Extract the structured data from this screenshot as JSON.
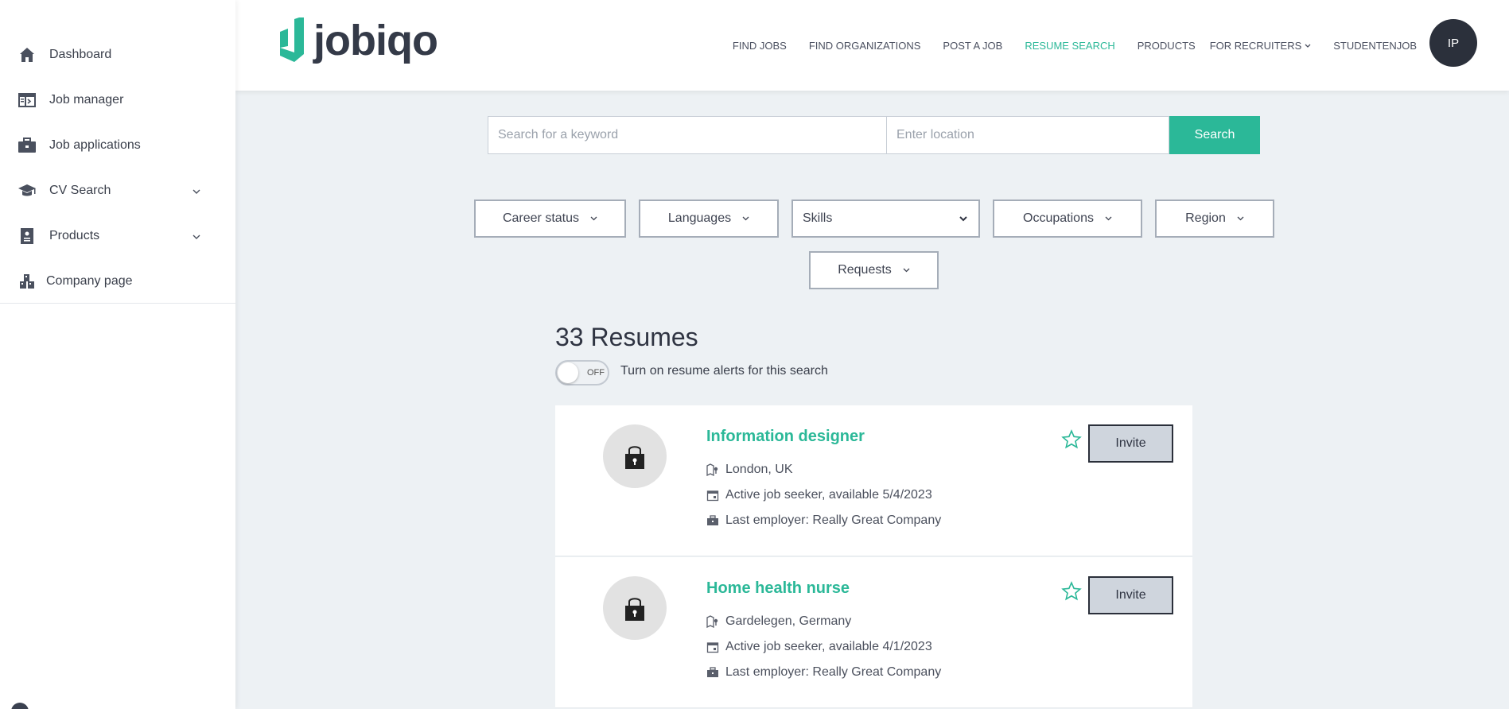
{
  "sidebar": {
    "items": [
      {
        "label": "Dashboard",
        "icon": "home-icon"
      },
      {
        "label": "Job manager",
        "icon": "job-manager-icon"
      },
      {
        "label": "Job applications",
        "icon": "briefcase-icon"
      },
      {
        "label": "CV Search",
        "icon": "graduation-cap-icon",
        "expandable": true
      },
      {
        "label": "Products",
        "icon": "products-icon",
        "expandable": true
      },
      {
        "label": "Company page",
        "icon": "company-icon"
      }
    ]
  },
  "header": {
    "logo_text": "jobiqo",
    "nav": [
      {
        "label": "FIND JOBS",
        "active": false
      },
      {
        "label": "FIND ORGANIZATIONS",
        "active": false
      },
      {
        "label": "POST A JOB",
        "active": false
      },
      {
        "label": "RESUME SEARCH",
        "active": true
      },
      {
        "label": "PRODUCTS",
        "active": false
      },
      {
        "label": "FOR RECRUITERS",
        "active": false,
        "dropdown": true
      },
      {
        "label": "STUDENTENJOB",
        "active": false
      }
    ],
    "avatar_initials": "IP"
  },
  "search": {
    "keyword_placeholder": "Search for a keyword",
    "location_placeholder": "Enter location",
    "button_label": "Search"
  },
  "filters": {
    "career_status": "Career status",
    "languages": "Languages",
    "skills": "Skills",
    "occupations": "Occupations",
    "region": "Region",
    "requests": "Requests"
  },
  "results": {
    "count_label": "33 Resumes",
    "toggle_state": "OFF",
    "alert_text": "Turn on resume alerts for this search",
    "cards": [
      {
        "title": "Information designer",
        "location": "London, UK",
        "status": "Active job seeker, available 5/4/2023",
        "employer": "Last employer: Really Great Company",
        "invite_label": "Invite"
      },
      {
        "title": "Home health nurse",
        "location": "Gardelegen, Germany",
        "status": "Active job seeker, available 4/1/2023",
        "employer": "Last employer: Really Great Company",
        "invite_label": "Invite"
      }
    ]
  },
  "colors": {
    "accent": "#2bb898",
    "dark": "#2b303b",
    "background": "#edf1f4"
  }
}
